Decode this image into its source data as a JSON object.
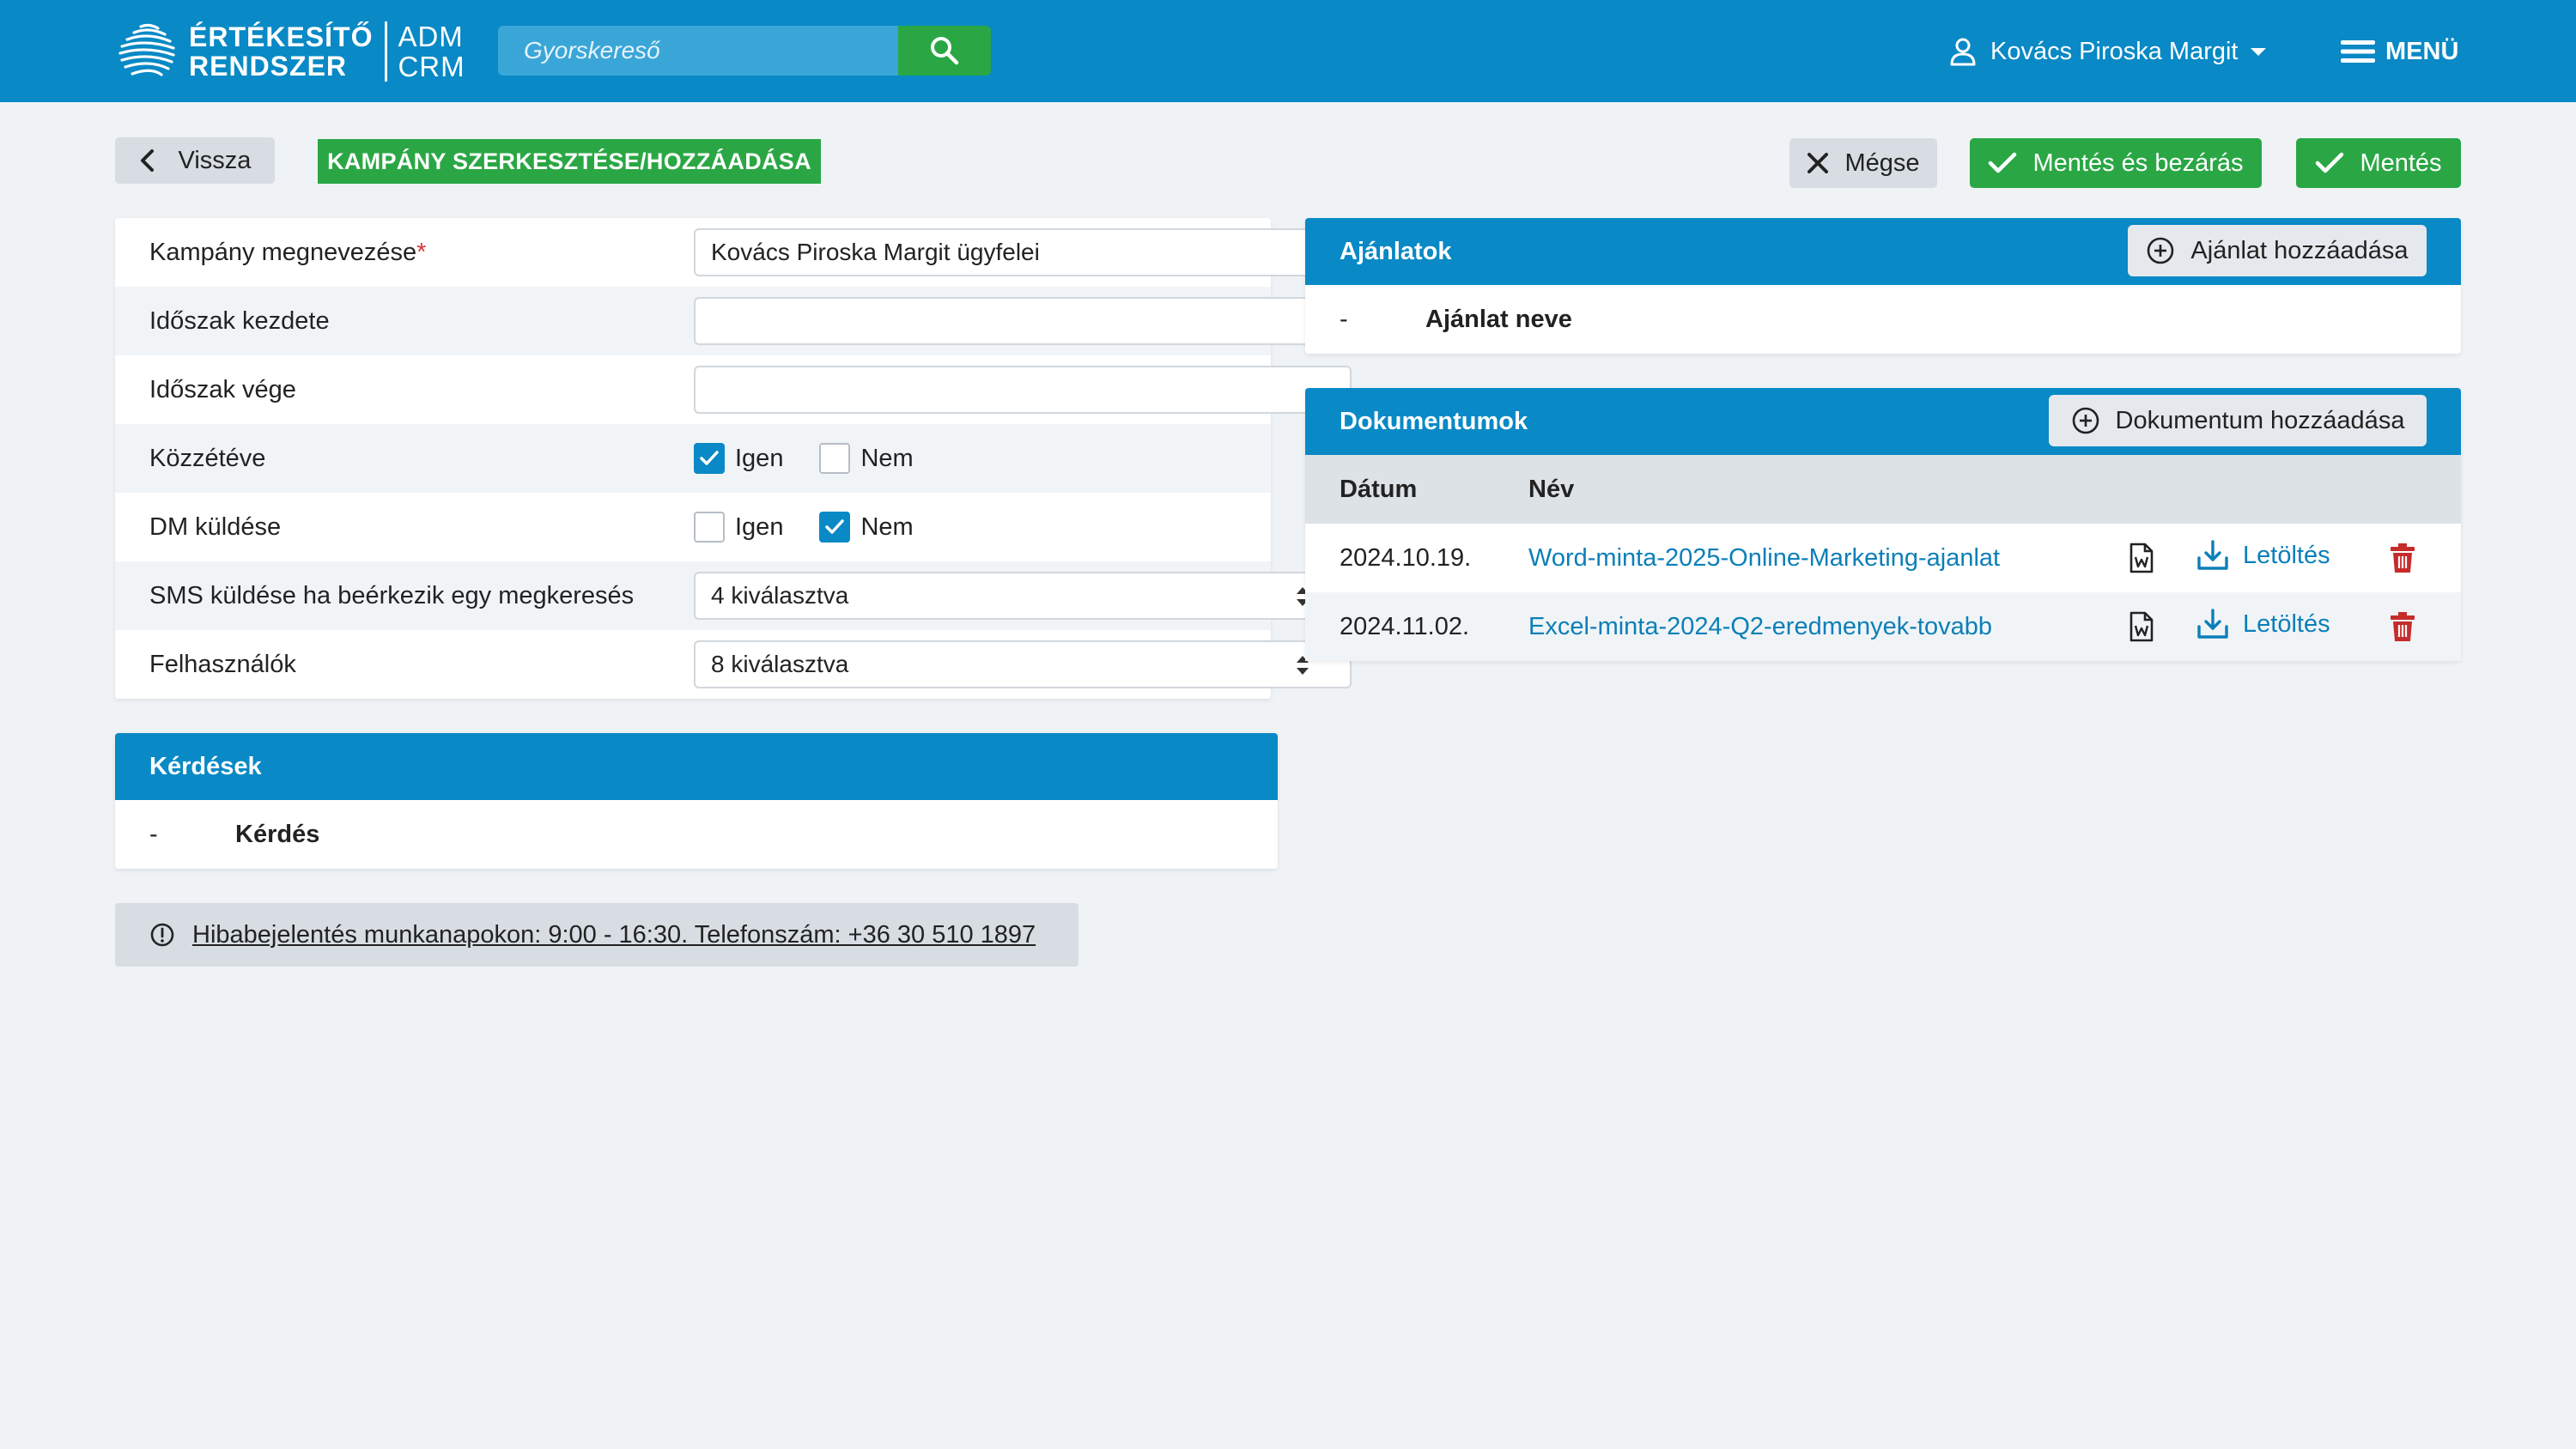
{
  "header": {
    "logo_line1": "ÉRTÉKESÍTŐ",
    "logo_line2": "RENDSZER",
    "logo_sub1": "ADM",
    "logo_sub2": "CRM",
    "search_placeholder": "Gyorskereső",
    "user_name": "Kovács Piroska Margit",
    "menu_label": "MENÜ"
  },
  "toolbar": {
    "back_label": "Vissza",
    "page_title": "KAMPÁNY SZERKESZTÉSE/HOZZÁADÁSA",
    "cancel_label": "Mégse",
    "save_close_label": "Mentés és bezárás",
    "save_label": "Mentés"
  },
  "form": {
    "name_label": "Kampány megnevezése",
    "name_required": "*",
    "name_value": "Kovács Piroska Margit ügyfelei",
    "start_label": "Időszak kezdete",
    "start_value": "",
    "end_label": "Időszak vége",
    "end_value": "",
    "published_label": "Közzétéve",
    "published_yes": "Igen",
    "published_no": "Nem",
    "published_value": "Igen",
    "dm_label": "DM küldése",
    "dm_yes": "Igen",
    "dm_no": "Nem",
    "dm_value": "Nem",
    "sms_label": "SMS küldése ha beérkezik egy megkeresés",
    "sms_value": "4 kiválasztva",
    "users_label": "Felhasználók",
    "users_value": "8 kiválasztva"
  },
  "questions": {
    "title": "Kérdések",
    "dash": "-",
    "column": "Kérdés"
  },
  "offers": {
    "title": "Ajánlatok",
    "add_label": "Ajánlat hozzáadása",
    "dash": "-",
    "column": "Ajánlat neve"
  },
  "documents": {
    "title": "Dokumentumok",
    "add_label": "Dokumentum hozzáadása",
    "col_date": "Dátum",
    "col_name": "Név",
    "download_label": "Letöltés",
    "rows": [
      {
        "date": "2024.10.19.",
        "name": "Word-minta-2025-Online-Marketing-ajanlat"
      },
      {
        "date": "2024.11.02.",
        "name": "Excel-minta-2024-Q2-eredmenyek-tovabb"
      }
    ]
  },
  "notice": {
    "text": "Hibabejelentés munkanapokon: 9:00 - 16:30. Telefonszám: +36 30 510 1897"
  },
  "colors": {
    "primary": "#0989c5",
    "success": "#2aa744",
    "danger": "#c62b2b",
    "link": "#0b7fb8",
    "background": "#eff3f6"
  },
  "icons": [
    "logo-mark-icon",
    "search-icon",
    "user-icon",
    "menu-icon",
    "chevron-left-icon",
    "close-icon",
    "check-icon",
    "plus-circle-icon",
    "word-file-icon",
    "download-icon",
    "trash-icon",
    "info-icon",
    "sort-arrows-icon"
  ]
}
